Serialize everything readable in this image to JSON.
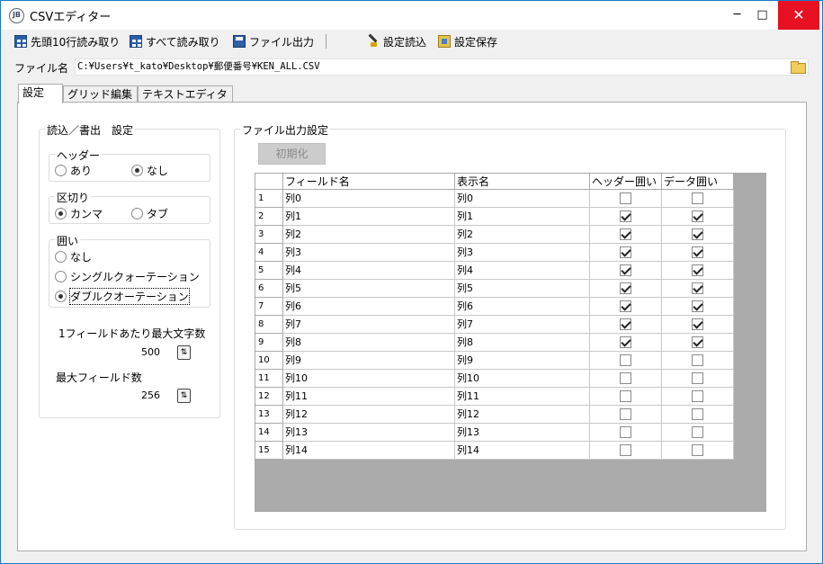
{
  "window": {
    "title": "CSVエディター",
    "icon": "app-logo-icon",
    "minimize": "─",
    "maximize": "□",
    "close": "✕"
  },
  "toolbar": {
    "read10_label": "先頭10行読み取り",
    "readall_label": "すべて読み取り",
    "export_label": "ファイル出力",
    "load_settings_label": "設定読込",
    "save_settings_label": "設定保存"
  },
  "file": {
    "label": "ファイル名",
    "path": "C:¥Users¥t_kato¥Desktop¥郵便番号¥KEN_ALL.CSV"
  },
  "tabs": [
    {
      "label": "設定",
      "active": true
    },
    {
      "label": "グリッド編集",
      "active": false
    },
    {
      "label": "テキストエディタ",
      "active": false
    }
  ],
  "rw_settings": {
    "title": "読込／書出　設定",
    "header": {
      "title": "ヘッダー",
      "options": [
        "あり",
        "なし"
      ],
      "selected": "なし"
    },
    "delimiter": {
      "title": "区切り",
      "options": [
        "カンマ",
        "タブ"
      ],
      "selected": "カンマ"
    },
    "quote": {
      "title": "囲い",
      "options": [
        "なし",
        "シングルクォーテーション",
        "ダブルクオーテーション"
      ],
      "selected": "ダブルクオーテーション"
    },
    "max_chars_label": "1フィールドあたり最大文字数",
    "max_chars_value": "500",
    "max_fields_label": "最大フィールド数",
    "max_fields_value": "256",
    "spin_glyph": "⇅"
  },
  "output_settings": {
    "title": "ファイル出力設定",
    "reset_label": "初期化",
    "columns": [
      "フィールド名",
      "表示名",
      "ヘッダー囲い",
      "データ囲い"
    ],
    "rows": [
      {
        "num": "1",
        "field": "列0",
        "display": "列0",
        "header_quote": false,
        "data_quote": false
      },
      {
        "num": "2",
        "field": "列1",
        "display": "列1",
        "header_quote": true,
        "data_quote": true
      },
      {
        "num": "3",
        "field": "列2",
        "display": "列2",
        "header_quote": true,
        "data_quote": true
      },
      {
        "num": "4",
        "field": "列3",
        "display": "列3",
        "header_quote": true,
        "data_quote": true
      },
      {
        "num": "5",
        "field": "列4",
        "display": "列4",
        "header_quote": true,
        "data_quote": true
      },
      {
        "num": "6",
        "field": "列5",
        "display": "列5",
        "header_quote": true,
        "data_quote": true
      },
      {
        "num": "7",
        "field": "列6",
        "display": "列6",
        "header_quote": true,
        "data_quote": true
      },
      {
        "num": "8",
        "field": "列7",
        "display": "列7",
        "header_quote": true,
        "data_quote": true
      },
      {
        "num": "9",
        "field": "列8",
        "display": "列8",
        "header_quote": true,
        "data_quote": true
      },
      {
        "num": "10",
        "field": "列9",
        "display": "列9",
        "header_quote": false,
        "data_quote": false
      },
      {
        "num": "11",
        "field": "列10",
        "display": "列10",
        "header_quote": false,
        "data_quote": false
      },
      {
        "num": "12",
        "field": "列11",
        "display": "列11",
        "header_quote": false,
        "data_quote": false
      },
      {
        "num": "13",
        "field": "列12",
        "display": "列12",
        "header_quote": false,
        "data_quote": false
      },
      {
        "num": "14",
        "field": "列13",
        "display": "列13",
        "header_quote": false,
        "data_quote": false
      },
      {
        "num": "15",
        "field": "列14",
        "display": "列14",
        "header_quote": false,
        "data_quote": false
      }
    ]
  }
}
